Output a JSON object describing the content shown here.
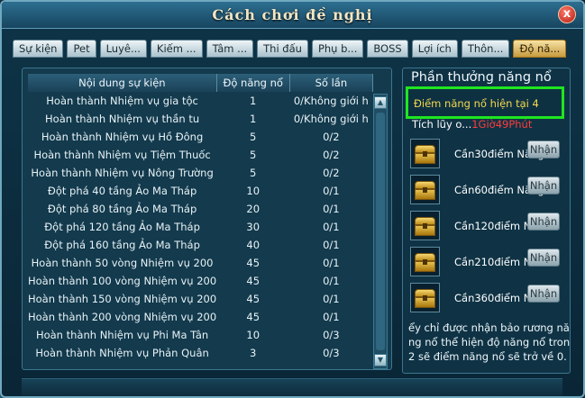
{
  "window": {
    "title": "Cách chơi đề nghị",
    "close_glyph": "x"
  },
  "tabs": [
    "Sự kiện",
    "Pet",
    "Luyê...",
    "Kiếm ...",
    "Tâm ...",
    "Thi đấu",
    "Phụ b...",
    "BOSS",
    "Lợi ích",
    "Thôn...",
    "Độ nă..."
  ],
  "table": {
    "headers": [
      "Nội dung sự kiện",
      "Độ năng nổ",
      "Số lần"
    ],
    "rows": [
      [
        "Hoàn thành Nhiệm vụ gia tộc",
        "1",
        "0/Không giới h"
      ],
      [
        "Hoàn thành Nhiệm vụ thần tu",
        "1",
        "0/Không giới h"
      ],
      [
        "Hoàn thành Nhiệm vụ Hồ Đông",
        "5",
        "0/2"
      ],
      [
        "Hoàn thành Nhiệm vụ Tiệm Thuốc",
        "5",
        "0/2"
      ],
      [
        "Hoàn thành Nhiệm vụ Nông Trường",
        "5",
        "0/2"
      ],
      [
        "Đột phá 40 tầng Ảo Ma Tháp",
        "10",
        "0/1"
      ],
      [
        "Đột phá 80 tầng Ảo Ma Tháp",
        "20",
        "0/1"
      ],
      [
        "Đột phá 120 tầng Ảo Ma Tháp",
        "30",
        "0/1"
      ],
      [
        "Đột phá 160 tầng Ảo Ma Tháp",
        "40",
        "0/1"
      ],
      [
        "Hoàn thành 50 vòng Nhiệm vụ 200",
        "45",
        "0/1"
      ],
      [
        "Hoàn thành 100 vòng Nhiệm vụ 200",
        "45",
        "0/1"
      ],
      [
        "Hoàn thành 150 vòng Nhiệm vụ 200",
        "45",
        "0/1"
      ],
      [
        "Hoàn thành 200 vòng Nhiệm vụ 200",
        "45",
        "0/1"
      ],
      [
        "Hoàn thành Nhiệm vụ Phi Ma Tân",
        "10",
        "0/3"
      ],
      [
        "Hoàn thành Nhiệm vụ Phản Quân",
        "3",
        "0/3"
      ]
    ]
  },
  "rewards": {
    "title": "Phần thưởng năng nổ",
    "current_label": "Điểm năng nổ hiện tại",
    "current_value": "4",
    "accum_label": "Tích lũy o...",
    "accum_timer": "1Giờ49Phút",
    "claim_label": "Nhận",
    "items": [
      {
        "text": "Cần30điểm Năng"
      },
      {
        "text": "Cần60điểm Năng"
      },
      {
        "text": "Cần120điểm Nă"
      },
      {
        "text": "Cần210điểm Nă"
      },
      {
        "text": "Cần360điểm Nă"
      }
    ],
    "note_lines": [
      "ểy chỉ được nhận bảo rương năng",
      "ng nổ thể hiện độ năng nổ tron",
      "2 sẽ điểm năng nổ sẽ trở về 0."
    ]
  },
  "colors": {
    "highlight_border": "#1fe61f",
    "timer": "#ff3b3b",
    "active_tab": "#c79b3f"
  }
}
